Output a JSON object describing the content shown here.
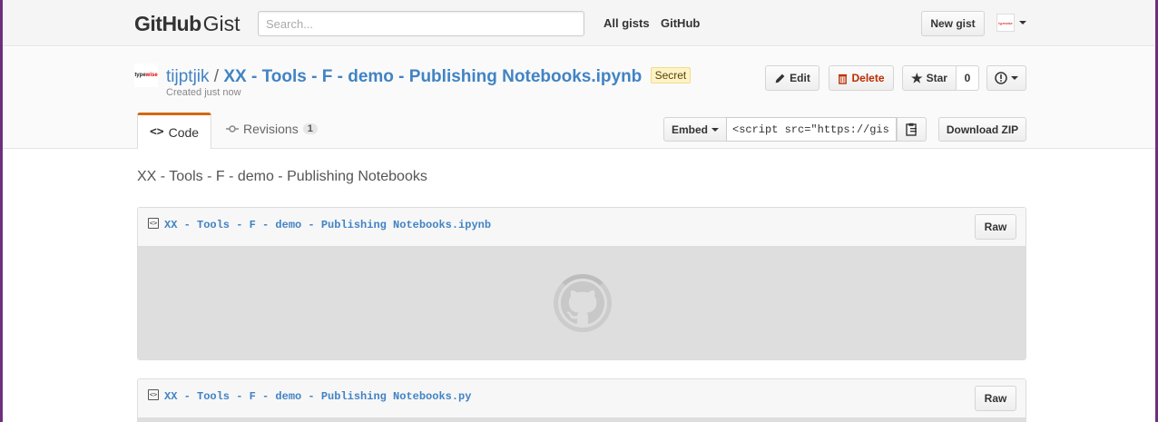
{
  "header": {
    "logo_brand": "GitHub",
    "logo_product": "Gist",
    "search_placeholder": "Search...",
    "nav_all_gists": "All gists",
    "nav_github": "GitHub",
    "new_gist": "New gist",
    "user_avatar_text": "typewise"
  },
  "gist": {
    "avatar_text_dark": "type",
    "avatar_text_red": "wise",
    "owner": "tijptjik",
    "separator": "/",
    "title": "XX - Tools - F - demo - Publishing Notebooks.ipynb",
    "secret_badge": "Secret",
    "created": "Created just now",
    "edit": "Edit",
    "delete": "Delete",
    "star": "Star",
    "star_count": "0"
  },
  "tabs": {
    "code": "Code",
    "revisions": "Revisions",
    "revisions_count": "1"
  },
  "embed": {
    "label": "Embed",
    "value": "<script src=\"https://gist",
    "download_zip": "Download ZIP"
  },
  "description": "XX - Tools - F - demo - Publishing Notebooks",
  "files": [
    {
      "name": "XX - Tools - F - demo - Publishing Notebooks.ipynb",
      "raw": "Raw"
    },
    {
      "name": "XX - Tools - F - demo - Publishing Notebooks.py",
      "raw": "Raw"
    }
  ],
  "colors": {
    "link": "#4183c4",
    "delete": "#bd2c00",
    "tab_accent": "#d26911",
    "window_border": "#6d2f7e"
  }
}
